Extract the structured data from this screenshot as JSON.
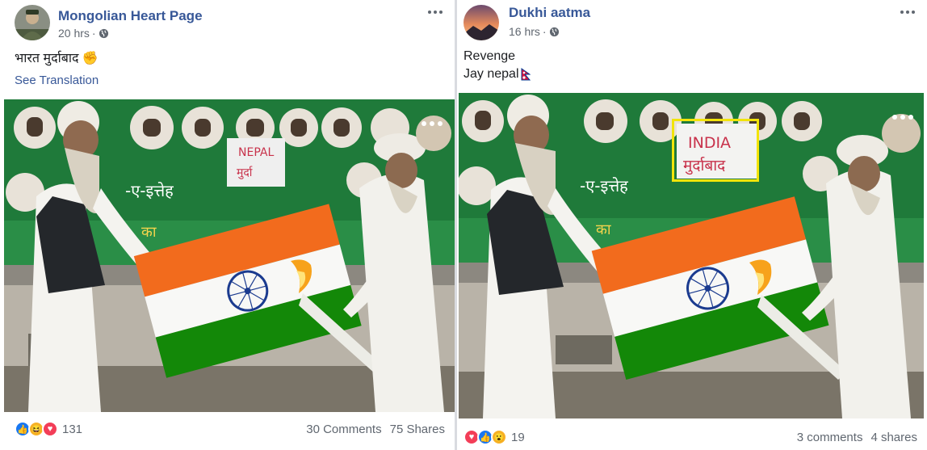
{
  "posts": [
    {
      "author": "Mongolian Heart Page",
      "time": "20 hrs",
      "separator": "·",
      "text_lines": [
        "भारत मुर्दाबाद ✊"
      ],
      "see_translation": "See Translation",
      "reactions": [
        "like-icon",
        "haha-icon",
        "love-icon"
      ],
      "reaction_count": "131",
      "comments": "30 Comments",
      "shares": "75 Shares"
    },
    {
      "author": "Dukhi aatma",
      "time": "16 hrs",
      "separator": "·",
      "text_lines": [
        "Revenge",
        "Jay nepal"
      ],
      "reactions": [
        "love-icon",
        "like-icon",
        "wow-icon"
      ],
      "reaction_count": "19",
      "comments": "3 comments",
      "shares": "4 shares",
      "photo_placard_text": [
        "INDIA",
        "मुर्दाबाद"
      ]
    }
  ],
  "photo_placard_left": [
    "NEPAL",
    "मुर्दा"
  ],
  "colors": {
    "link": "#385898",
    "meta": "#606770",
    "saffron": "#f26b1d",
    "green": "#138808",
    "banner_green": "#1f7a3a",
    "highlight": "#f2e40a"
  }
}
